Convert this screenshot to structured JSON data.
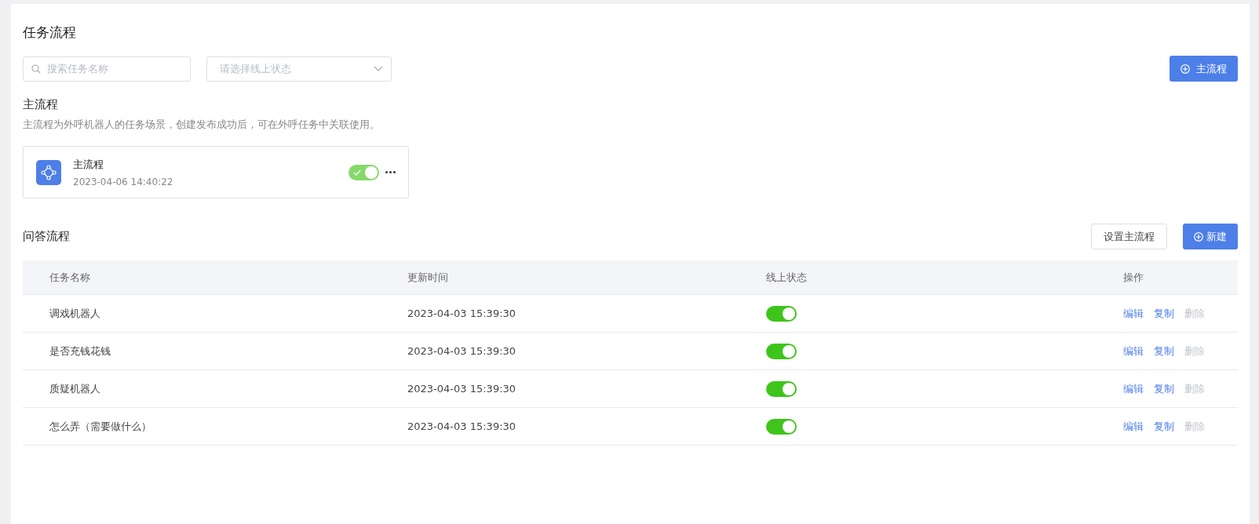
{
  "title": "任务流程",
  "filters": {
    "search": {
      "placeholder": "搜索任务名称"
    },
    "status_select": {
      "placeholder": "请选择线上状态"
    }
  },
  "add_main_button": "主流程",
  "main_section": {
    "title": "主流程",
    "description": "主流程为外呼机器人的任务场景，创建发布成功后，可在外呼任务中关联使用。",
    "card": {
      "name": "主流程",
      "time": "2023-04-06 14:40:22",
      "on": true
    }
  },
  "qa_section": {
    "title": "问答流程",
    "buttons": [
      "设置主流程",
      "新建"
    ],
    "table": {
      "columns": [
        "任务名称",
        "更新时间",
        "线上状态",
        "操作"
      ],
      "rows": [
        {
          "name": "调戏机器人",
          "time": "2023-04-03 15:39:30",
          "on": true,
          "actions": [
            {
              "label": "编辑",
              "disabled": false
            },
            {
              "label": "复制",
              "disabled": false
            },
            {
              "label": "删除",
              "disabled": true
            }
          ]
        },
        {
          "name": "是否充钱花钱",
          "time": "2023-04-03 15:39:30",
          "on": true,
          "actions": [
            {
              "label": "编辑",
              "disabled": false
            },
            {
              "label": "复制",
              "disabled": false
            },
            {
              "label": "删除",
              "disabled": true
            }
          ]
        },
        {
          "name": "质疑机器人",
          "time": "2023-04-03 15:39:30",
          "on": true,
          "actions": [
            {
              "label": "编辑",
              "disabled": false
            },
            {
              "label": "复制",
              "disabled": false
            },
            {
              "label": "删除",
              "disabled": true
            }
          ]
        },
        {
          "name": "怎么弄（需要做什么）",
          "time": "2023-04-03 15:39:30",
          "on": true,
          "actions": [
            {
              "label": "编辑",
              "disabled": false
            },
            {
              "label": "复制",
              "disabled": false
            },
            {
              "label": "删除",
              "disabled": true
            }
          ]
        }
      ]
    }
  }
}
